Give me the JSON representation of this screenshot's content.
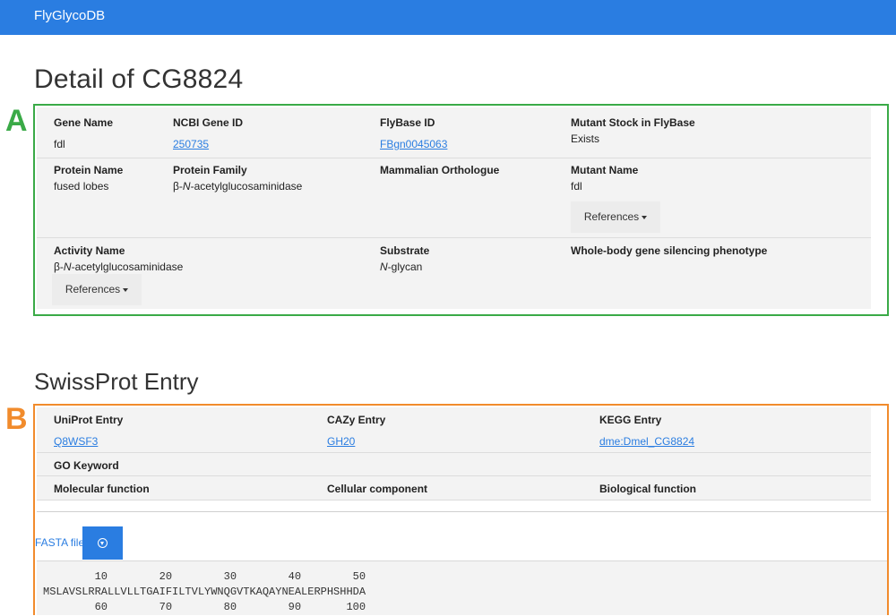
{
  "navbar": {
    "brand": "FlyGlycoDB"
  },
  "page_title": "Detail of CG8824",
  "panel_labels": {
    "a": "A",
    "b": "B"
  },
  "detail": {
    "gene_name": {
      "label": "Gene Name",
      "value": "fdl"
    },
    "ncbi_gene_id": {
      "label": "NCBI Gene ID",
      "value": "250735"
    },
    "flybase_id": {
      "label": "FlyBase ID",
      "value": "FBgn0045063"
    },
    "mutant_stock": {
      "label": "Mutant Stock in FlyBase",
      "value": "Exists"
    },
    "protein_name": {
      "label": "Protein Name",
      "value": "fused lobes"
    },
    "protein_family": {
      "label": "Protein Family",
      "value_prefix": "β-",
      "value_italic": "N",
      "value_suffix": "-acetylglucosaminidase"
    },
    "mammalian_orthologue": {
      "label": "Mammalian Orthologue"
    },
    "mutant_name": {
      "label": "Mutant Name",
      "value": "fdl"
    },
    "references_button_1": "References",
    "activity_name": {
      "label": "Activity Name",
      "value_prefix": "β-",
      "value_italic": "N",
      "value_suffix": "-acetylglucosaminidase"
    },
    "substrate": {
      "label": "Substrate",
      "value_italic": "N",
      "value_suffix": "-glycan"
    },
    "silencing_phenotype": {
      "label": "Whole-body gene silencing phenotype"
    },
    "references_button_2": "References"
  },
  "swissprot": {
    "title": "SwissProt Entry",
    "uniprot": {
      "label": "UniProt Entry",
      "value": "Q8WSF3"
    },
    "cazy": {
      "label": "CAZy Entry",
      "value": "GH20"
    },
    "kegg": {
      "label": "KEGG Entry",
      "value": "dme:Dmel_CG8824"
    },
    "go_keyword": {
      "label": "GO Keyword"
    },
    "molecular_function": {
      "label": "Molecular function"
    },
    "cellular_component": {
      "label": "Cellular component"
    },
    "biological_function": {
      "label": "Biological function"
    },
    "fasta_link": "FASTA file",
    "download_icon": "download-circle-icon",
    "sequence": {
      "ruler_top": "        10        20        30        40        50",
      "line_1": "MSLAVSLRRALLVLLTGAIFILTVLYWNQGVTKAQAYNEALERPHSHHDA",
      "ruler_bottom": "        60        70        80        90       100"
    }
  },
  "colors": {
    "navbar": "#2a7de1",
    "panel_a": "#3aaa47",
    "panel_b": "#f18b2c",
    "link": "#2a7de1"
  }
}
